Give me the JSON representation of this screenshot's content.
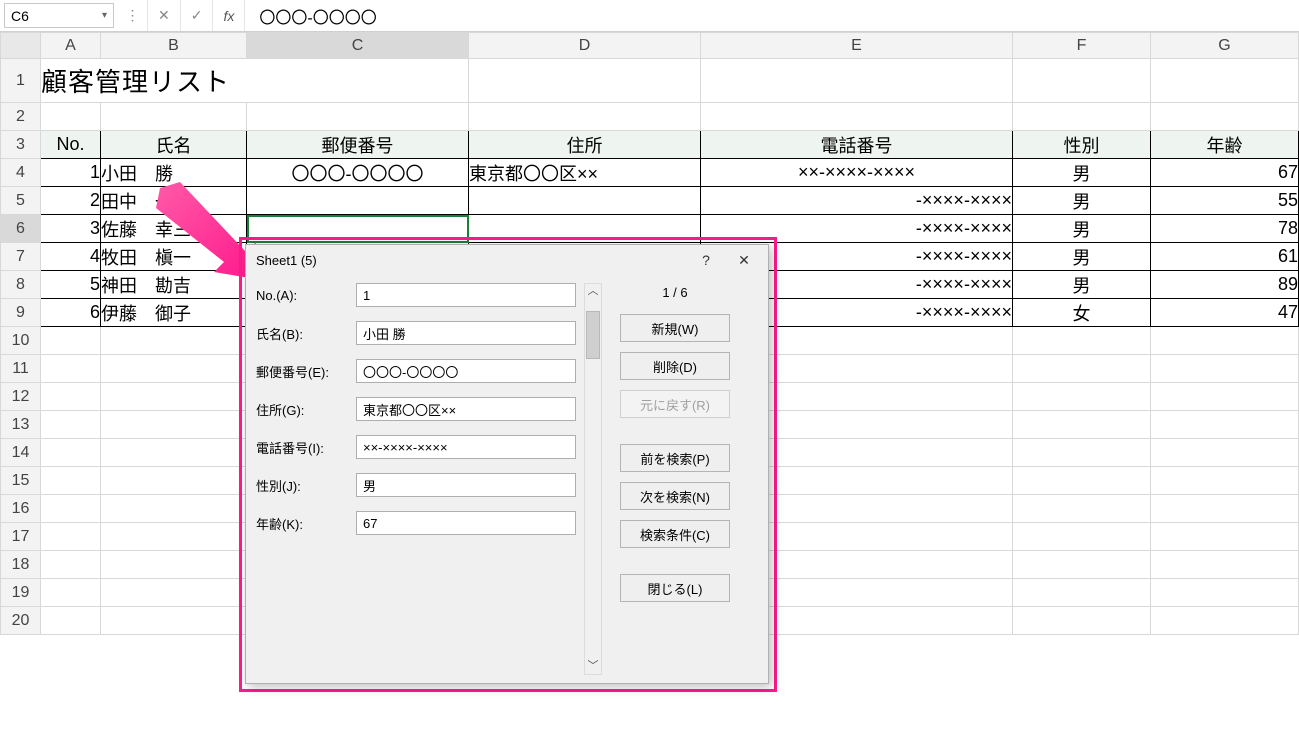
{
  "namebox": {
    "ref": "C6"
  },
  "formula": "〇〇〇-〇〇〇〇",
  "columns": [
    "A",
    "B",
    "C",
    "D",
    "E",
    "F",
    "G"
  ],
  "selected_col": "C",
  "selected_row": 6,
  "rows_visible": 20,
  "title": "顧客管理リスト",
  "headers": [
    "No.",
    "氏名",
    "郵便番号",
    "住所",
    "電話番号",
    "性別",
    "年齢"
  ],
  "data": [
    {
      "no": "1",
      "name": "小田　勝",
      "zip": "〇〇〇-〇〇〇〇",
      "addr": "東京都〇〇区××",
      "tel": "××-××××-××××",
      "sex": "男",
      "age": "67"
    },
    {
      "no": "2",
      "name": "田中　一",
      "zip": "",
      "addr": "",
      "tel": "-××××-××××",
      "sex": "男",
      "age": "55"
    },
    {
      "no": "3",
      "name": "佐藤　幸三",
      "zip": "",
      "addr": "",
      "tel": "-××××-××××",
      "sex": "男",
      "age": "78"
    },
    {
      "no": "4",
      "name": "牧田　槇一",
      "zip": "",
      "addr": "",
      "tel": "-××××-××××",
      "sex": "男",
      "age": "61"
    },
    {
      "no": "5",
      "name": "神田　勘吉",
      "zip": "",
      "addr": "",
      "tel": "-××××-××××",
      "sex": "男",
      "age": "89"
    },
    {
      "no": "6",
      "name": "伊藤　御子",
      "zip": "",
      "addr": "",
      "tel": "-××××-××××",
      "sex": "女",
      "age": "47"
    }
  ],
  "dialog": {
    "title": "Sheet1 (5)",
    "counter": "1 / 6",
    "fields": {
      "no": {
        "label": "No.(A):",
        "value": "1"
      },
      "name": {
        "label": "氏名(B):",
        "value": "小田 勝"
      },
      "zip": {
        "label": "郵便番号(E):",
        "value": "〇〇〇-〇〇〇〇"
      },
      "addr": {
        "label": "住所(G):",
        "value": "東京都〇〇区××"
      },
      "tel": {
        "label": "電話番号(I):",
        "value": "××-××××-××××"
      },
      "sex": {
        "label": "性別(J):",
        "value": "男"
      },
      "age": {
        "label": "年齢(K):",
        "value": "67"
      }
    },
    "buttons": {
      "new": "新規(W)",
      "delete": "削除(D)",
      "undo": "元に戻す(R)",
      "prev": "前を検索(P)",
      "next": "次を検索(N)",
      "crit": "検索条件(C)",
      "close": "閉じる(L)"
    }
  }
}
